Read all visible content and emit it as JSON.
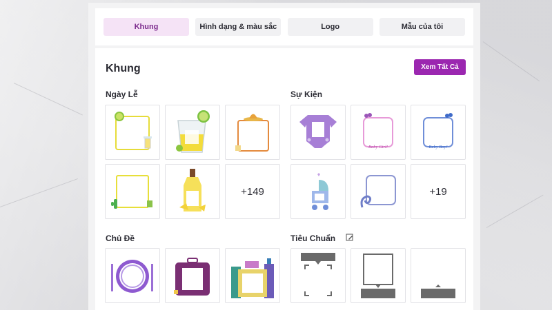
{
  "tabs": [
    {
      "label": "Khung",
      "active": true
    },
    {
      "label": "Hình dạng & màu sắc",
      "active": false
    },
    {
      "label": "Logo",
      "active": false
    },
    {
      "label": "Mẫu của tôi",
      "active": false
    }
  ],
  "section": {
    "title": "Khung",
    "see_all_label": "Xem Tất Cả"
  },
  "groups": {
    "holidays": {
      "title": "Ngày Lễ",
      "more_label": "+149"
    },
    "events": {
      "title": "Sự Kiện",
      "more_label": "+19",
      "baby_girl_text": "Baby Girl!",
      "baby_boy_text": "Baby Boy!"
    },
    "themes": {
      "title": "Chủ Đề"
    },
    "standard": {
      "title": "Tiêu Chuẩn"
    }
  },
  "colors": {
    "accent": "#9b27b0",
    "active_tab_bg": "#f5e3f6",
    "active_tab_text": "#7b2a8c"
  },
  "icons": [
    "lime-frame-icon",
    "drink-glass-icon",
    "sombrero-frame-icon",
    "onesie-icon",
    "baby-girl-frame-icon",
    "baby-boy-frame-icon",
    "cactus-frame-icon",
    "tequila-bottle-icon",
    "stroller-icon",
    "swirl-frame-icon",
    "plate-icon",
    "suitcase-icon",
    "bottles-frame-icon",
    "caption-top-frame-icon",
    "caption-bottom-frame-icon",
    "caption-bar-icon"
  ]
}
